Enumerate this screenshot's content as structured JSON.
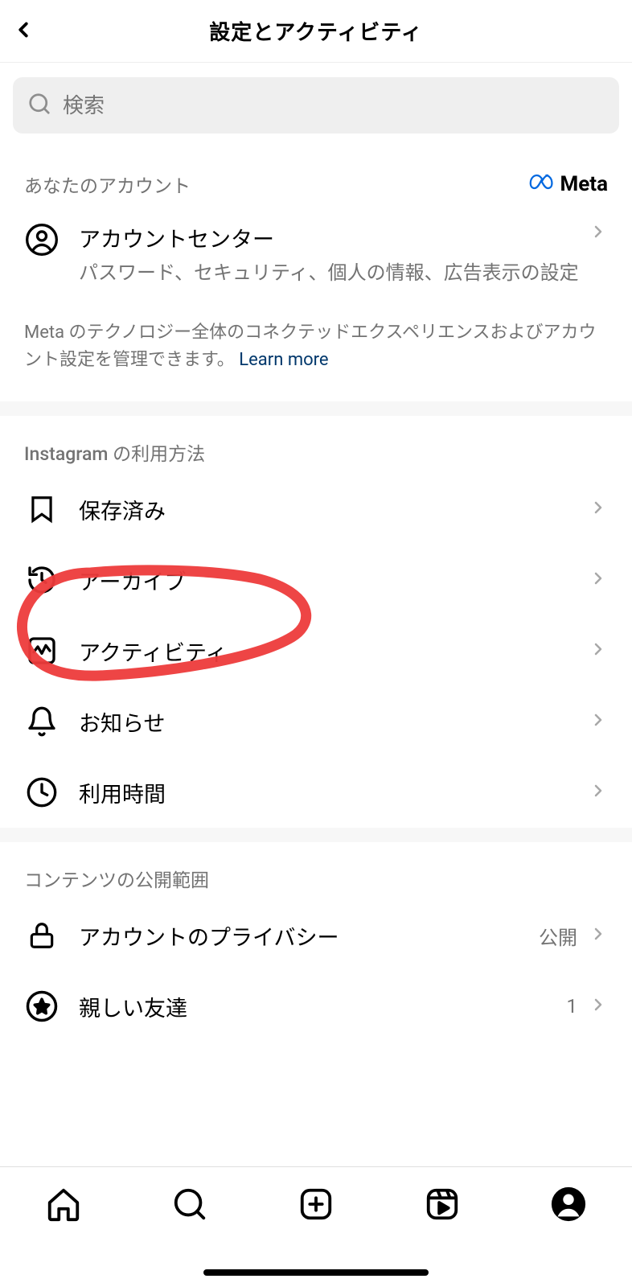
{
  "header": {
    "title": "設定とアクティビティ"
  },
  "search": {
    "placeholder": "検索"
  },
  "section1": {
    "title": "あなたのアカウント",
    "brand": "Meta",
    "item": {
      "label": "アカウントセンター",
      "sublabel": "パスワード、セキュリティ、個人の情報、広告表示の設定"
    },
    "footer": "Meta のテクノロジー全体のコネクテッドエクスペリエンスおよびアカウント設定を管理できます。",
    "learn_more": "Learn more"
  },
  "section2": {
    "title": "Instagram の利用方法",
    "items": [
      {
        "label": "保存済み"
      },
      {
        "label": "アーカイブ"
      },
      {
        "label": "アクティビティ"
      },
      {
        "label": "お知らせ"
      },
      {
        "label": "利用時間"
      }
    ]
  },
  "section3": {
    "title": "コンテンツの公開範囲",
    "items": [
      {
        "label": "アカウントのプライバシー",
        "trailing": "公開"
      },
      {
        "label": "親しい友達",
        "trailing": "1"
      }
    ]
  }
}
